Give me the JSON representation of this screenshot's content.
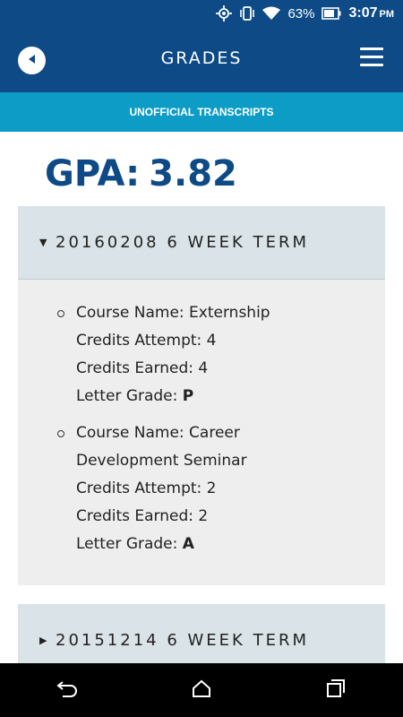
{
  "status_bar": {
    "icons": [
      "gps-icon",
      "vibrate-icon",
      "wifi-icon",
      "battery-icon"
    ],
    "battery": "63%",
    "time": "3:07",
    "ampm": "PM"
  },
  "app_bar": {
    "title": "GRADES",
    "back_icon": "back-icon",
    "menu_icon": "menu-icon"
  },
  "sub_bar": {
    "label": "UNOFFICIAL TRANSCRIPTS"
  },
  "gpa": {
    "label": "GPA:",
    "value": "3.82"
  },
  "terms": [
    {
      "title": "20160208 6 WEEK TERM",
      "expanded": true,
      "courses": [
        {
          "name_label": "Course Name:",
          "name_line1": "Externship",
          "name_line2": "",
          "attempt_label": "Credits Attempt:",
          "attempt": "4",
          "earned_label": "Credits Earned:",
          "earned": "4",
          "grade_label": "Letter Grade:",
          "grade": "P"
        },
        {
          "name_label": "Course Name:",
          "name_line1": "Career",
          "name_line2": "Development Seminar",
          "attempt_label": "Credits Attempt:",
          "attempt": "2",
          "earned_label": "Credits Earned:",
          "earned": "2",
          "grade_label": "Letter Grade:",
          "grade": "A"
        }
      ]
    },
    {
      "title": "20151214 6 WEEK TERM",
      "expanded": false,
      "courses": []
    }
  ],
  "nav_bar": {
    "icons": [
      "back-nav-icon",
      "home-icon",
      "recents-icon"
    ]
  },
  "colors": {
    "primary": "#0d4a86",
    "accent": "#0d9cc6",
    "term_header": "#d9e3e8",
    "term_body": "#eeeeee"
  }
}
